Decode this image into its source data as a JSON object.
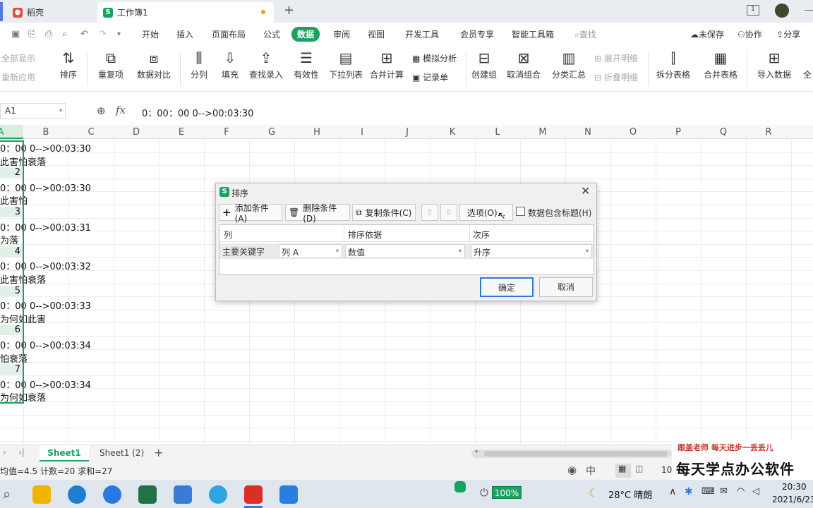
{
  "tabs": {
    "docer": "稻壳",
    "workbook": "工作簿1",
    "add": "+"
  },
  "menu": {
    "items": [
      "开始",
      "插入",
      "页面布局",
      "公式",
      "数据",
      "审阅",
      "视图",
      "开发工具",
      "会员专享",
      "智能工具箱"
    ],
    "active": "数据",
    "search": "查找",
    "unsaved": "未保存",
    "collab": "协作",
    "share": "分享"
  },
  "ribbon": {
    "show_all": "全部显示",
    "reapply": "重新应用",
    "sort": "排序",
    "dup": "重复项",
    "compare": "数据对比",
    "split": "分列",
    "fill": "填充",
    "lookup": "查找录入",
    "valid": "有效性",
    "dropdown": "下拉列表",
    "consolidate": "合并计算",
    "simulate": "模拟分析",
    "record": "记录单",
    "group": "创建组",
    "ungroup": "取消组合",
    "subtotal": "分类汇总",
    "expand": "展开明细",
    "collapse": "折叠明细",
    "split_table": "拆分表格",
    "merge_table": "合并表格",
    "import": "导入数据",
    "all": "全"
  },
  "formula": {
    "namebox": "A1",
    "fx": "fx",
    "content": "0：00：00 0-->00:03:30"
  },
  "columns": [
    "A",
    "B",
    "C",
    "D",
    "E",
    "F",
    "G",
    "H",
    "I",
    "J",
    "K",
    "L",
    "M",
    "N",
    "O",
    "P",
    "Q",
    "R"
  ],
  "cells": [
    "0：00 0-->00:03:30",
    "此害怕衰落",
    "2",
    "0：00 0-->00:03:30",
    "此害怕",
    "3",
    "0：00 0-->00:03:31",
    "为落",
    "4",
    "0：00 0-->00:03:32",
    "此害怕衰落",
    "5",
    "0：00 0-->00:03:33",
    "为何如此害",
    "6",
    "0：00 0-->00:03:34",
    "怕衰落",
    "7",
    "0：00 0-->00:03:34",
    "为何如衰落"
  ],
  "dialog": {
    "title": "排序",
    "add": "添加条件(A)",
    "delete": "删除条件(D)",
    "copy": "复制条件(C)",
    "options": "选项(O)...",
    "header_check": "数据包含标题(H)",
    "col_head": "列",
    "basis_head": "排序依据",
    "order_head": "次序",
    "key_label": "主要关键字",
    "key_value": "列 A",
    "basis_value": "数值",
    "order_value": "升序",
    "ok": "确定",
    "cancel": "取消"
  },
  "sheets": {
    "active": "Sheet1",
    "other": "Sheet1 (2)",
    "add": "+"
  },
  "status": {
    "stats": "均值=4.5  计数=20  求和=27",
    "zoom": "10"
  },
  "watermark": {
    "line1": "跟盖老师  每天进步一丢丢儿",
    "line2": "每天学点办公软件"
  },
  "taskbar": {
    "battery": "100%",
    "weather": "28°C  晴朗",
    "time": "20:30",
    "date": "2021/6/23"
  },
  "colors": {
    "accent": "#1aa260",
    "selection": "#1e9e5a",
    "primary_btn": "#2f7bd6"
  }
}
